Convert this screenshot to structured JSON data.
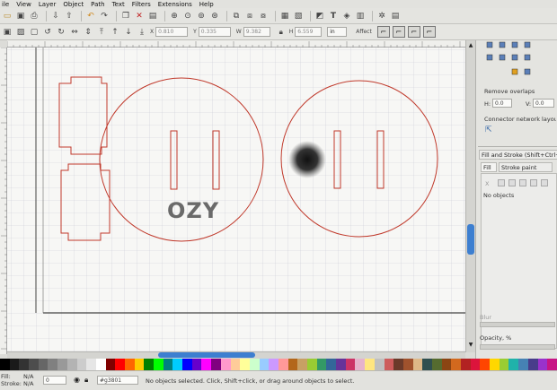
{
  "menu": [
    "ile",
    "View",
    "Layer",
    "Object",
    "Path",
    "Text",
    "Filters",
    "Extensions",
    "Help"
  ],
  "toolbar_icons": [
    "open-icon",
    "save-icon",
    "print-icon",
    "import-icon",
    "export-icon",
    "undo-icon",
    "redo-icon",
    "copy-icon",
    "cut-icon",
    "paste-icon",
    "zoom-selection-icon",
    "zoom-drawing-icon",
    "zoom-page-icon",
    "duplicate-icon",
    "clone-icon",
    "unlink-icon",
    "group-icon",
    "ungroup-icon",
    "node-editor-icon",
    "fill-stroke-icon",
    "text-font-icon",
    "xml-editor-icon",
    "align-icon",
    "preferences-icon",
    "document-props-icon"
  ],
  "controls": {
    "x_value": "0.810",
    "y_value": "0.335",
    "w_value": "9.382",
    "h_value": "6.559",
    "unit": "in",
    "affect_label": "Affect"
  },
  "canvas": {
    "logo_text": "OZY"
  },
  "dock": {
    "remove_overlaps_label": "Remove overlaps",
    "h_label": "H:",
    "h_value": "0.0",
    "v_label": "V:",
    "v_value": "0.0",
    "connector_label": "Connector network layou",
    "fill_stroke_title": "Fill and Stroke (Shift+Ctrl+F)",
    "fill_tab": "Fill",
    "stroke_paint_tab": "Stroke paint",
    "x_mark": "X",
    "no_objects": "No objects",
    "blur_label": "Blur",
    "opacity_label": "Opacity, %"
  },
  "status": {
    "fill_label": "Fill:",
    "stroke_label": "Stroke:",
    "fill_value": "N/A",
    "stroke_value": "N/A",
    "opacity_value": "0",
    "layer_name": "#g3801",
    "message": "No objects selected. Click, Shift+click, or drag around objects to select."
  },
  "palette_colors": [
    "#000000",
    "#1a1a1a",
    "#333333",
    "#4d4d4d",
    "#666666",
    "#808080",
    "#999999",
    "#b3b3b3",
    "#cccccc",
    "#e6e6e6",
    "#ffffff",
    "#800000",
    "#ff0000",
    "#ff6600",
    "#ffcc00",
    "#008000",
    "#00ff00",
    "#008080",
    "#00ccff",
    "#0000ff",
    "#6600cc",
    "#ff00ff",
    "#800080",
    "#ff99cc",
    "#ffcc99",
    "#ffff99",
    "#ccffcc",
    "#99ccff",
    "#cc99ff",
    "#ff9999",
    "#b3661a",
    "#c8a064",
    "#99cc33",
    "#339966",
    "#336699",
    "#663399",
    "#cc3366",
    "#e6b3cc",
    "#ffe680",
    "#c0c0c0",
    "#cd5c5c",
    "#6b3a2a",
    "#a0522d",
    "#deb887",
    "#2f4f4f",
    "#556b2f",
    "#8b4513",
    "#d2691e",
    "#b22222",
    "#dc143c",
    "#ff4500",
    "#ffd700",
    "#9acd32",
    "#20b2aa",
    "#4682b4",
    "#483d8b",
    "#9932cc",
    "#c71585"
  ]
}
